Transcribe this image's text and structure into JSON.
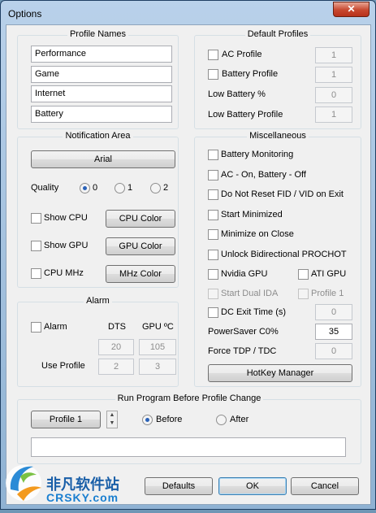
{
  "window": {
    "title": "Options",
    "close_glyph": "✕"
  },
  "profile_names": {
    "title": "Profile Names",
    "fields": [
      "Performance",
      "Game",
      "Internet",
      "Battery"
    ]
  },
  "default_profiles": {
    "title": "Default Profiles",
    "ac_profile": {
      "label": "AC Profile",
      "value": "1"
    },
    "battery_profile": {
      "label": "Battery Profile",
      "value": "1"
    },
    "low_battery_pct": {
      "label": "Low Battery %",
      "value": "0"
    },
    "low_battery_profile": {
      "label": "Low Battery Profile",
      "value": "1"
    }
  },
  "notification": {
    "title": "Notification Area",
    "font_button": "Arial",
    "quality_label": "Quality",
    "quality_options": [
      "0",
      "1",
      "2"
    ],
    "show_cpu": "Show CPU",
    "cpu_color": "CPU Color",
    "show_gpu": "Show GPU",
    "gpu_color": "GPU Color",
    "cpu_mhz": "CPU MHz",
    "mhz_color": "MHz Color"
  },
  "alarm": {
    "title": "Alarm",
    "alarm_label": "Alarm",
    "dts_label": "DTS",
    "gpu_label": "GPU ºC",
    "dts_value": "20",
    "gpu_value": "105",
    "use_profile_label": "Use Profile",
    "use_profile_dts": "2",
    "use_profile_gpu": "3"
  },
  "misc": {
    "title": "Miscellaneous",
    "battery_monitoring": "Battery Monitoring",
    "ac_on_battery_off": "AC - On, Battery - Off",
    "do_not_reset": "Do Not Reset FID / VID on Exit",
    "start_minimized": "Start Minimized",
    "minimize_on_close": "Minimize on Close",
    "unlock_prochot": "Unlock Bidirectional PROCHOT",
    "nvidia_gpu": "Nvidia GPU",
    "ati_gpu": "ATI GPU",
    "start_dual_ida": "Start Dual IDA",
    "profile_1": "Profile 1",
    "dc_exit_time": {
      "label": "DC Exit Time (s)",
      "value": "0"
    },
    "powersaver": {
      "label": "PowerSaver C0%",
      "value": "35"
    },
    "force_tdp": {
      "label": "Force TDP / TDC",
      "value": "0"
    },
    "hotkey_manager": "HotKey Manager"
  },
  "run_program": {
    "title": "Run Program Before Profile Change",
    "profile_button": "Profile 1",
    "before": "Before",
    "after": "After",
    "path_value": ""
  },
  "footer": {
    "defaults": "Defaults",
    "ok": "OK",
    "cancel": "Cancel"
  },
  "watermark": {
    "text_cn": "非凡软件站",
    "text_en": "CRSKY.com"
  }
}
